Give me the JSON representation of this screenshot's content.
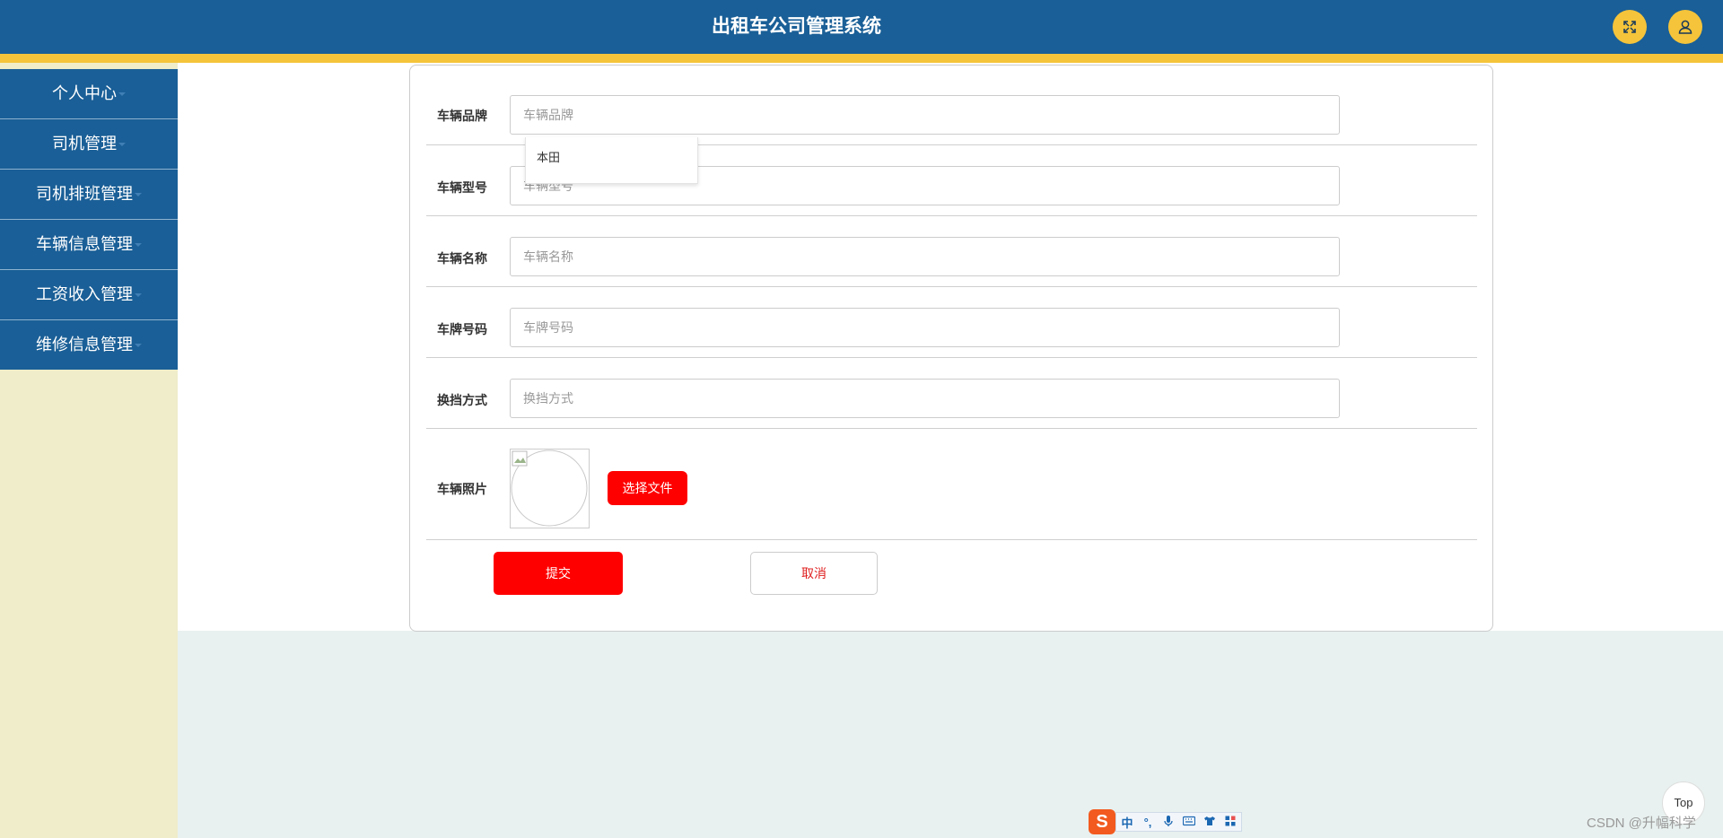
{
  "header": {
    "title": "出租车公司管理系统",
    "fullscreen_icon": "fullscreen-icon",
    "user_icon": "user-icon"
  },
  "sidebar": {
    "items": [
      {
        "label": "个人中心"
      },
      {
        "label": "司机管理"
      },
      {
        "label": "司机排班管理"
      },
      {
        "label": "车辆信息管理"
      },
      {
        "label": "工资收入管理"
      },
      {
        "label": "维修信息管理"
      }
    ]
  },
  "form": {
    "fields": [
      {
        "label": "车辆品牌",
        "placeholder": "车辆品牌",
        "value": ""
      },
      {
        "label": "车辆型号",
        "placeholder": "车辆型号",
        "value": ""
      },
      {
        "label": "车辆名称",
        "placeholder": "车辆名称",
        "value": ""
      },
      {
        "label": "车牌号码",
        "placeholder": "车牌号码",
        "value": ""
      },
      {
        "label": "换挡方式",
        "placeholder": "换挡方式",
        "value": ""
      }
    ],
    "autocomplete": [
      "本田"
    ],
    "photo_label": "车辆照片",
    "choose_file_label": "选择文件",
    "submit_label": "提交",
    "cancel_label": "取消"
  },
  "floating": {
    "top_label": "Top",
    "watermark": "CSDN @升幅科学"
  },
  "ime": {
    "logo": "S",
    "items": [
      "中",
      "°,",
      "mic-icon",
      "keyboard-icon",
      "shirt-icon",
      "grid-icon"
    ]
  },
  "colors": {
    "header": "#1a5f97",
    "stripe": "#f5c43a",
    "sidebar_bg": "#efedca",
    "page_bg": "#e8f1ef",
    "primary_button": "#ff0000"
  }
}
